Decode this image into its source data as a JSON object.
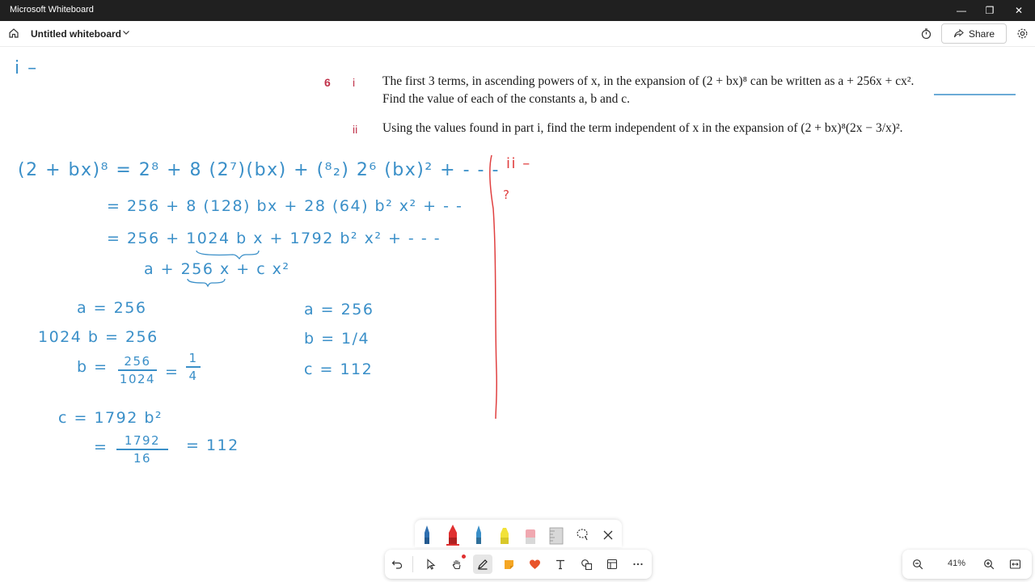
{
  "window": {
    "app_title": "Microsoft Whiteboard",
    "minimize_label": "—",
    "restore_label": "❐",
    "close_label": "✕"
  },
  "header": {
    "board_title": "Untitled whiteboard",
    "share_label": "Share"
  },
  "question": {
    "number": "6",
    "part_i_label": "i",
    "part_i_line1": "The first 3 terms, in ascending powers of x, in the expansion of (2 + bx)⁸ can be written as a + 256x + cx².",
    "part_i_line2": "Find the value of each of the constants a, b and c.",
    "part_ii_label": "ii",
    "part_ii_text": "Using the values found in part i, find the term independent of x in the expansion of (2 + bx)⁸(2x − 3/x)²."
  },
  "handwriting": {
    "part_marker": "i –",
    "exp_line1": "(2 + bx)⁸ = 2⁸ + 8 (2⁷)(bx) + (⁸₂) 2⁶ (bx)² + - - -",
    "exp_line2": "= 256 + 8 (128) bx + 28 (64) b² x² + - -",
    "exp_line3": "= 256 + 1024 b x + 1792 b² x² + - - -",
    "exp_line4": "a   + 256 x   + c x²",
    "a_eq": "a = 256",
    "b_eq1": "1024 b = 256",
    "b_eq2_lhs": "b =",
    "b_frac_num": "256",
    "b_frac_den": "1024",
    "b_eq2_mid": "=",
    "b_frac2_num": "1",
    "b_frac2_den": "4",
    "c_eq1": "c = 1792 b²",
    "c_eq2_lhs": "=",
    "c_frac_num": "1792",
    "c_frac_den": "16",
    "c_eq2_rhs": "= 112",
    "summary_a": "a = 256",
    "summary_b": "b = 1/4",
    "summary_c": "c = 112",
    "part_ii_marker": "ii –",
    "part_ii_mark2": "?"
  },
  "zoom": {
    "level": "41%"
  },
  "colors": {
    "ink_blue": "#3a8fc8",
    "ink_red": "#e04040",
    "question_number": "#c0324a"
  }
}
